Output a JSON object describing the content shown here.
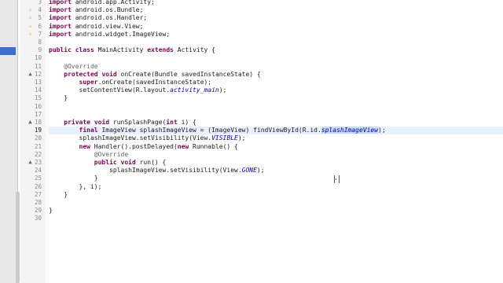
{
  "gutter_markers": {
    "warning": "⚠",
    "override": "▲"
  },
  "lines": [
    {
      "num": "3",
      "tokens": [
        {
          "t": "import",
          "c": "kw"
        },
        {
          "t": " android.app.Activity;"
        }
      ]
    },
    {
      "num": "4",
      "tokens": [
        {
          "t": "import",
          "c": "kw"
        },
        {
          "t": " android.os.Bundle;"
        }
      ]
    },
    {
      "num": "5",
      "tokens": [
        {
          "t": "import",
          "c": "kw"
        },
        {
          "t": " android.os.Handler;"
        }
      ]
    },
    {
      "num": "6",
      "tokens": [
        {
          "t": "import",
          "c": "kw"
        },
        {
          "t": " android.view.View;"
        }
      ]
    },
    {
      "num": "7",
      "tokens": [
        {
          "t": "import",
          "c": "kw"
        },
        {
          "t": " android.widget.ImageView;"
        }
      ]
    },
    {
      "num": "8",
      "tokens": []
    },
    {
      "num": "9",
      "tokens": [
        {
          "t": "public",
          "c": "kw"
        },
        {
          "t": " "
        },
        {
          "t": "class",
          "c": "kw"
        },
        {
          "t": " MainActivity "
        },
        {
          "t": "extends",
          "c": "kw"
        },
        {
          "t": " Activity {"
        }
      ]
    },
    {
      "num": "10",
      "tokens": []
    },
    {
      "num": "11",
      "tokens": [
        {
          "t": "    "
        },
        {
          "t": "@Override",
          "c": "ann"
        }
      ]
    },
    {
      "num": "12",
      "tokens": [
        {
          "t": "    "
        },
        {
          "t": "protected",
          "c": "kw"
        },
        {
          "t": " "
        },
        {
          "t": "void",
          "c": "kw"
        },
        {
          "t": " onCreate(Bundle savedInstanceState) {"
        }
      ]
    },
    {
      "num": "13",
      "tokens": [
        {
          "t": "        "
        },
        {
          "t": "super",
          "c": "kw"
        },
        {
          "t": ".onCreate(savedInstanceState);"
        }
      ]
    },
    {
      "num": "14",
      "tokens": [
        {
          "t": "        setContentView(R.layout."
        },
        {
          "t": "activity_main",
          "c": "fld"
        },
        {
          "t": ");"
        }
      ]
    },
    {
      "num": "15",
      "tokens": [
        {
          "t": "    }"
        }
      ]
    },
    {
      "num": "16",
      "tokens": []
    },
    {
      "num": "17",
      "tokens": []
    },
    {
      "num": "18",
      "tokens": [
        {
          "t": "    "
        },
        {
          "t": "private",
          "c": "kw"
        },
        {
          "t": " "
        },
        {
          "t": "void",
          "c": "kw"
        },
        {
          "t": " runSplashPage("
        },
        {
          "t": "int",
          "c": "kw"
        },
        {
          "t": " i) {"
        }
      ]
    },
    {
      "num": "19",
      "tokens": [
        {
          "t": "        "
        },
        {
          "t": "final",
          "c": "kw"
        },
        {
          "t": " ImageView splashImageView = (ImageView) findViewById(R.id."
        },
        {
          "t": "splashImageView",
          "c": "fld-sel"
        },
        {
          "t": ");"
        }
      ]
    },
    {
      "num": "20",
      "tokens": [
        {
          "t": "        splashImageView.setVisibility(View."
        },
        {
          "t": "VISIBLE",
          "c": "fld"
        },
        {
          "t": ");"
        }
      ]
    },
    {
      "num": "21",
      "tokens": [
        {
          "t": "        "
        },
        {
          "t": "new",
          "c": "kw"
        },
        {
          "t": " Handler().postDelayed("
        },
        {
          "t": "new",
          "c": "kw"
        },
        {
          "t": " Runnable() {"
        }
      ]
    },
    {
      "num": "22",
      "tokens": [
        {
          "t": "            "
        },
        {
          "t": "@Override",
          "c": "ann"
        }
      ]
    },
    {
      "num": "23",
      "tokens": [
        {
          "t": "            "
        },
        {
          "t": "public",
          "c": "kw"
        },
        {
          "t": " "
        },
        {
          "t": "void",
          "c": "kw"
        },
        {
          "t": " run() {"
        }
      ]
    },
    {
      "num": "24",
      "tokens": [
        {
          "t": "                splashImageView.setVisibility(View."
        },
        {
          "t": "GONE",
          "c": "fld"
        },
        {
          "t": ");"
        }
      ]
    },
    {
      "num": "25",
      "tokens": [
        {
          "t": "            }"
        }
      ]
    },
    {
      "num": "26",
      "tokens": [
        {
          "t": "        }, i);"
        }
      ]
    },
    {
      "num": "27",
      "tokens": [
        {
          "t": "    }"
        }
      ]
    },
    {
      "num": "28",
      "tokens": []
    },
    {
      "num": "29",
      "tokens": [
        {
          "t": "}"
        }
      ]
    },
    {
      "num": "30",
      "tokens": []
    }
  ]
}
